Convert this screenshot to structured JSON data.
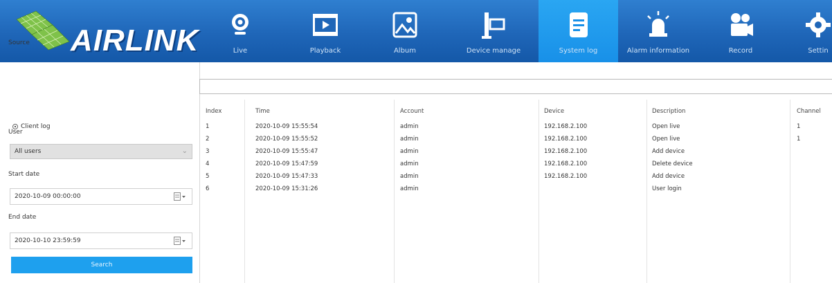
{
  "brand": {
    "name": "AIRLINK",
    "accent": "#1ea0ee",
    "bar_color": "#1f66b8"
  },
  "nav": [
    {
      "label": "Live",
      "icon": "webcam-icon",
      "active": false
    },
    {
      "label": "Playback",
      "icon": "video-player-icon",
      "active": false
    },
    {
      "label": "Album",
      "icon": "image-icon",
      "active": false
    },
    {
      "label": "Device manage",
      "icon": "device-icon",
      "active": false
    },
    {
      "label": "System log",
      "icon": "document-icon",
      "active": true
    },
    {
      "label": "Alarm information",
      "icon": "alarm-light-icon",
      "active": false
    },
    {
      "label": "Record",
      "icon": "film-camera-icon",
      "active": false
    },
    {
      "label": "Settin",
      "icon": "gear-icon",
      "active": false
    }
  ],
  "filters": {
    "source_label": "Source",
    "client_log_label": "Client log",
    "user_label": "User",
    "user_value": "All users",
    "start_label": "Start date",
    "start_value": "2020-10-09 00:00:00",
    "end_label": "End date",
    "end_value": "2020-10-10 23:59:59",
    "search_label": "Search"
  },
  "table": {
    "columns": [
      "Index",
      "Time",
      "Account",
      "Device",
      "Description",
      "Channel"
    ],
    "rows": [
      [
        "1",
        "2020-10-09 15:55:54",
        "admin",
        "192.168.2.100",
        "Open live",
        "1"
      ],
      [
        "2",
        "2020-10-09 15:55:52",
        "admin",
        "192.168.2.100",
        "Open live",
        "1"
      ],
      [
        "3",
        "2020-10-09 15:55:47",
        "admin",
        "192.168.2.100",
        "Add device",
        ""
      ],
      [
        "4",
        "2020-10-09 15:47:59",
        "admin",
        "192.168.2.100",
        "Delete device",
        ""
      ],
      [
        "5",
        "2020-10-09 15:47:33",
        "admin",
        "192.168.2.100",
        "Add device",
        ""
      ],
      [
        "6",
        "2020-10-09 15:31:26",
        "admin",
        "",
        "User login",
        ""
      ]
    ]
  }
}
